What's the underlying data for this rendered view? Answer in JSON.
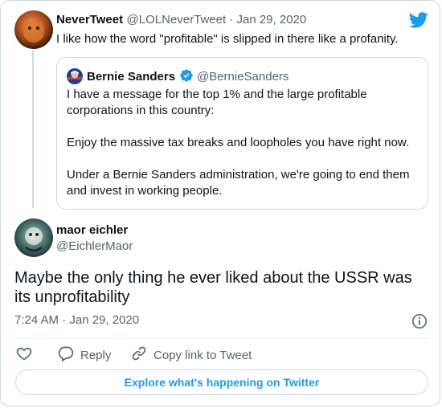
{
  "reply_tweet": {
    "display_name": "NeverTweet",
    "handle_date": "@LOLNeverTweet · Jan 29, 2020",
    "text": "I like how the word \"profitable\" is slipped in there like a profanity."
  },
  "quoted_tweet": {
    "display_name": "Bernie Sanders",
    "handle": "@BernieSanders",
    "paragraphs": [
      "I have a message for the top 1% and the large profitable corporations in this country:",
      "Enjoy the massive tax breaks and loopholes you have right now.",
      "Under a Bernie Sanders administration, we're going to end them and invest in working people."
    ]
  },
  "main_tweet": {
    "display_name": "maor eichler",
    "handle": "@EichlerMaor",
    "text": "Maybe the only thing he ever liked about the USSR was its unprofitability",
    "timestamp": "7:24 AM · Jan 29, 2020"
  },
  "actions": {
    "reply_label": "Reply",
    "copy_link_label": "Copy link to Tweet"
  },
  "explore_label": "Explore what's happening on Twitter",
  "colors": {
    "twitter_blue": "#1d9bf0",
    "text_primary": "#0f1419",
    "text_secondary": "#536471",
    "border": "#cfd9de"
  },
  "icons": [
    "twitter-logo-icon",
    "verified-badge-icon",
    "info-icon",
    "heart-icon",
    "reply-icon",
    "link-icon"
  ]
}
